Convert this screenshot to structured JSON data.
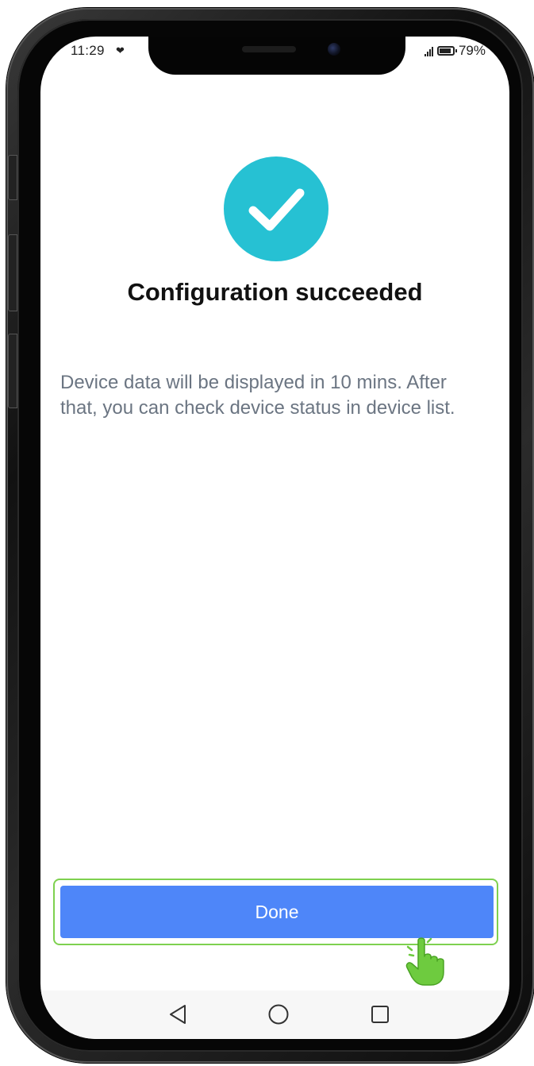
{
  "status_bar": {
    "time": "11:29",
    "battery": "79%",
    "battery_level": 0.79
  },
  "main": {
    "title": "Configuration succeeded",
    "description": "Device data will be displayed in 10 mins. After that, you can check device status in device list.",
    "icon": "check-circle-icon",
    "accent_color": "#26c1d3"
  },
  "footer": {
    "done_label": "Done",
    "button_color": "#4e86f9",
    "highlight_color": "#7ed14f"
  },
  "nav_bar": {
    "icons": [
      "back-triangle-icon",
      "home-circle-icon",
      "recents-square-icon"
    ]
  }
}
